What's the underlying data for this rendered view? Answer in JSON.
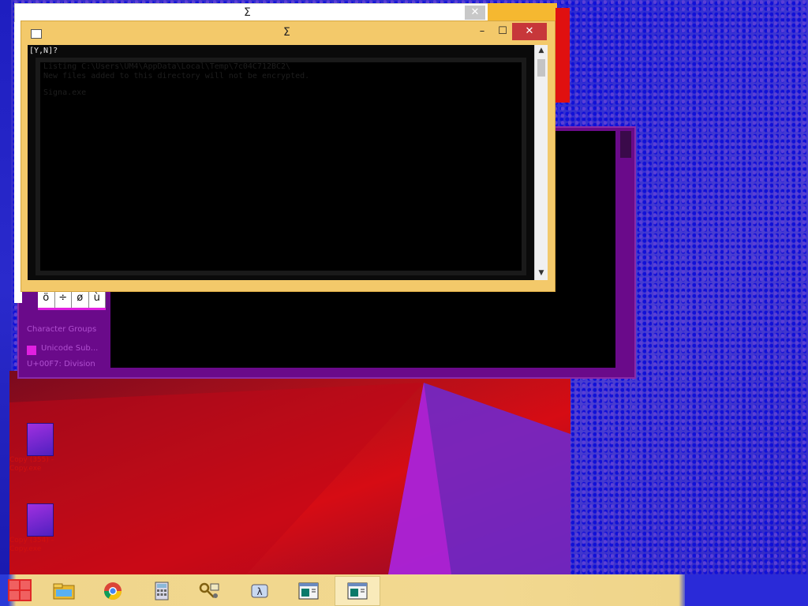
{
  "back_window": {
    "title": "Σ",
    "close_label": "✕"
  },
  "main_window": {
    "title": "Σ",
    "minimize_label": "–",
    "maximize_label": "☐",
    "close_label": "✕",
    "console": {
      "prompt": "[Y,N]?",
      "lines": [
        "Listing C:\\Users\\UM4\\AppData\\Local\\Temp\\7c04C712BC2\\",
        "New files added to this directory will not be encrypted.",
        "",
        "  Signa.exe"
      ]
    },
    "scroll_up": "▲",
    "scroll_down": "▼"
  },
  "charmap": {
    "chars": [
      "ö",
      "÷",
      "ø",
      "ù"
    ]
  },
  "purple_window": {
    "side_items": [
      "Character Groups",
      "Unicode Sub...",
      "U+00F7: Division"
    ]
  },
  "desktop_icons": [
    {
      "label": "Copy (355) - Copy.exe"
    },
    {
      "label": "Copy (354) - Copy.exe"
    }
  ],
  "taskbar": {
    "items": [
      {
        "name": "file-explorer",
        "icon": "folder-icon"
      },
      {
        "name": "chrome",
        "icon": "chrome-icon"
      },
      {
        "name": "calculator",
        "icon": "calculator-icon"
      },
      {
        "name": "key-tool",
        "icon": "key-icon"
      },
      {
        "name": "lambda-app",
        "icon": "lambda-icon"
      },
      {
        "name": "console-window-1",
        "icon": "console-icon"
      },
      {
        "name": "console-window-2",
        "icon": "console-icon"
      }
    ]
  },
  "colors": {
    "console_title_bar": "#f3c96a",
    "close_button": "#c7373a",
    "taskbar": "#f2d890"
  }
}
